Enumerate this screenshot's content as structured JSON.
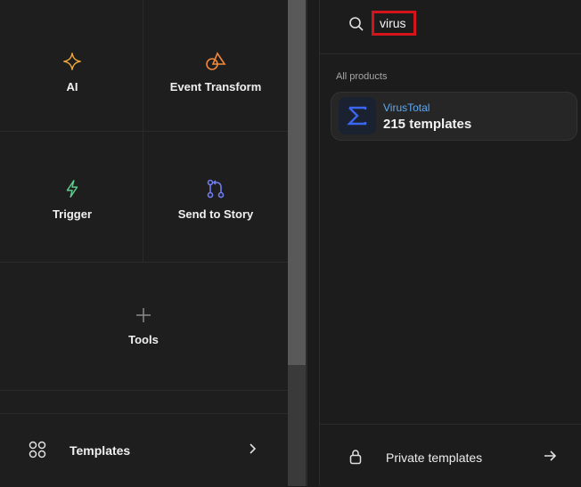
{
  "left_panel": {
    "tiles": [
      {
        "label": "AI",
        "icon": "sparkle-icon",
        "color": "#f0a53c"
      },
      {
        "label": "Event Transform",
        "icon": "shapes-icon",
        "color": "#f0873c"
      },
      {
        "label": "Trigger",
        "icon": "lightning-icon",
        "color": "#5cc98a"
      },
      {
        "label": "Send to Story",
        "icon": "git-merge-icon",
        "color": "#6f7cf0"
      },
      {
        "label": "Tools",
        "icon": "plus-icon",
        "color": "#8a8a8a"
      }
    ],
    "templates_row": {
      "label": "Templates",
      "icon": "grid-circles-icon"
    }
  },
  "search": {
    "value": "virus",
    "highlight_color": "#d4141b"
  },
  "results": {
    "section_label": "All products",
    "products": [
      {
        "name": "VirusTotal",
        "count_label": "215 templates",
        "logo": "virustotal-logo",
        "accent": "#3a66f0"
      }
    ]
  },
  "private_templates": {
    "label": "Private templates",
    "icon": "lock-icon"
  }
}
